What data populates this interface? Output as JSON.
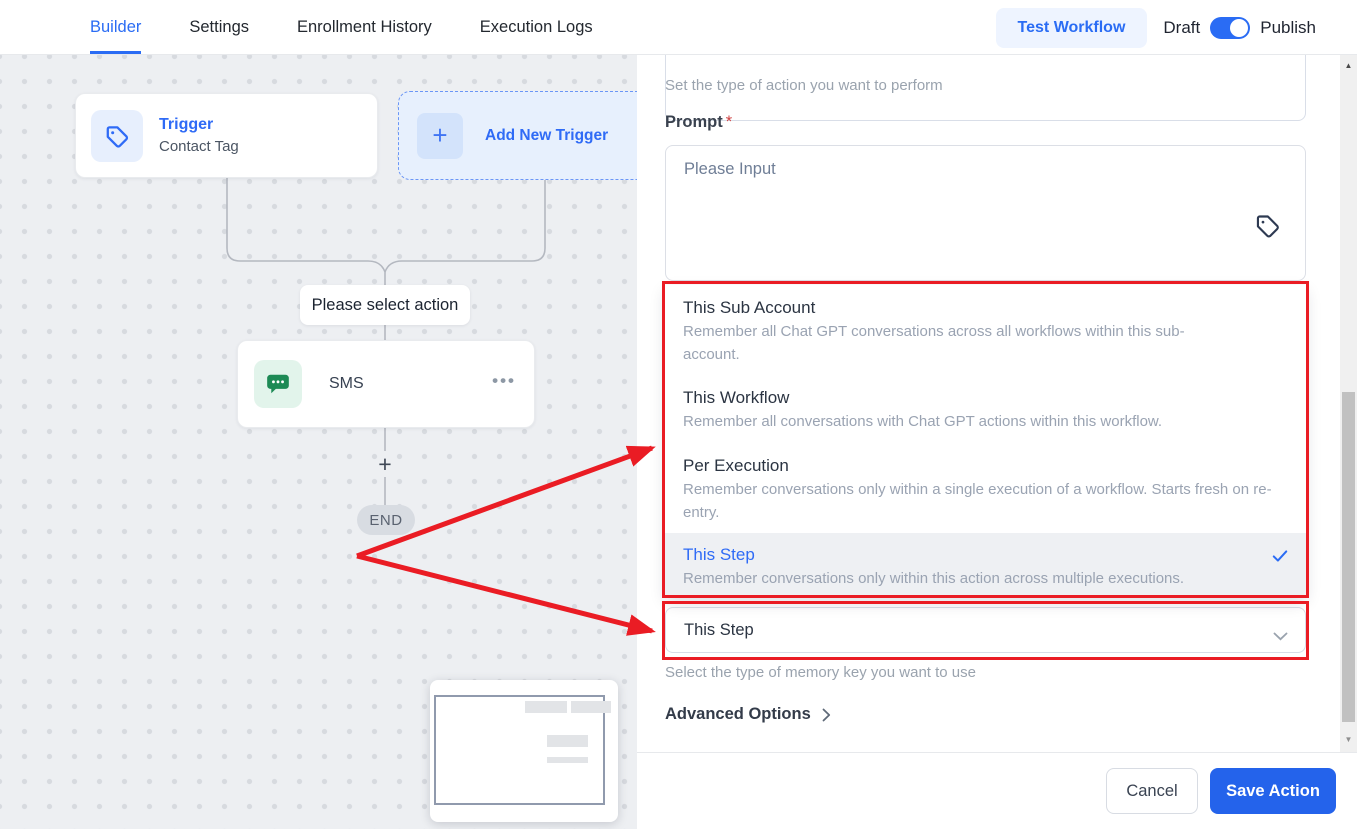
{
  "nav": {
    "tabs": [
      {
        "label": "Builder",
        "active": true
      },
      {
        "label": "Settings",
        "active": false
      },
      {
        "label": "Enrollment History",
        "active": false
      },
      {
        "label": "Execution Logs",
        "active": false
      }
    ],
    "test_workflow_label": "Test Workflow",
    "draft_label": "Draft",
    "publish_label": "Publish",
    "publish_toggle_state": "on"
  },
  "canvas": {
    "trigger_card": {
      "title": "Trigger",
      "subtitle": "Contact Tag"
    },
    "add_trigger": {
      "label": "Add New Trigger",
      "plus": "+"
    },
    "select_action_label": "Please select action",
    "sms_card": {
      "label": "SMS",
      "menu_icon": "•••"
    },
    "plus_symbol": "+",
    "end_label": "END"
  },
  "panel": {
    "action_helper": "Set the type of action you want to perform",
    "prompt": {
      "label": "Prompt",
      "required_mark": "*",
      "placeholder": "Please Input"
    },
    "dropdown": {
      "options": [
        {
          "title": "This Sub Account",
          "description": "Remember all Chat GPT conversations across all workflows within this sub-account.",
          "selected": false
        },
        {
          "title": "This Workflow",
          "description": "Remember all conversations with Chat GPT actions within this workflow.",
          "selected": false
        },
        {
          "title": "Per Execution",
          "description": "Remember conversations only within a single execution of a workflow. Starts fresh on re-entry.",
          "selected": false
        },
        {
          "title": "This Step",
          "description": "Remember conversations only within this action across multiple executions.",
          "selected": true
        }
      ]
    },
    "memory_select": {
      "value": "This Step",
      "helper": "Select the type of memory key you want to use"
    },
    "advanced_options_label": "Advanced Options",
    "footer": {
      "cancel_label": "Cancel",
      "save_label": "Save Action"
    }
  },
  "icons": {
    "scroll_up": "▲",
    "scroll_down": "▼"
  },
  "colors": {
    "accent_blue": "#2a6cf4",
    "save_blue": "#2463eb",
    "annotation_red": "#ea1c24",
    "sms_green": "#1d8a55",
    "canvas_bg": "#edeff2",
    "selected_row_bg": "#eef0f3",
    "end_pill_bg": "#d8dce2"
  }
}
